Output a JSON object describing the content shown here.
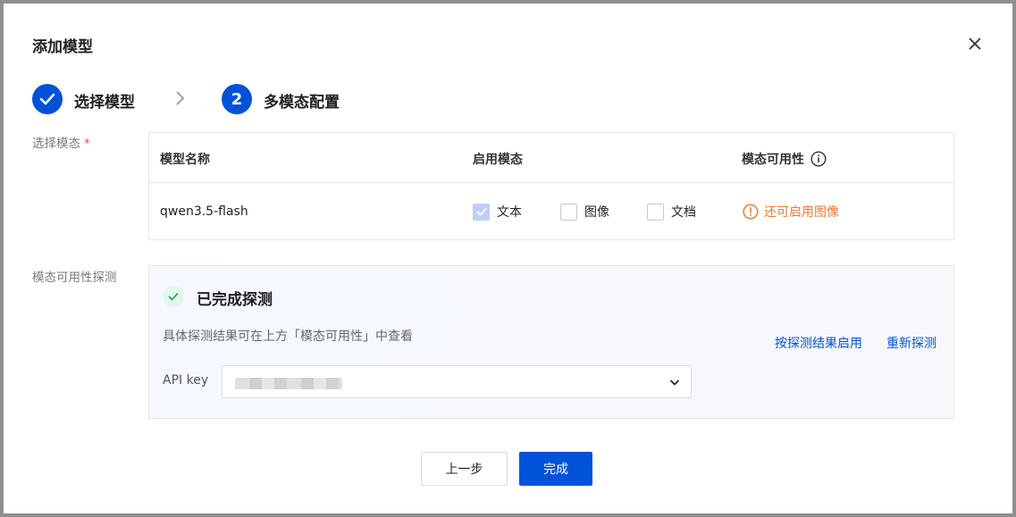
{
  "dialog": {
    "title": "添加模型"
  },
  "steps": [
    {
      "label": "选择模型",
      "status": "done"
    },
    {
      "label": "多模态配置",
      "number": "2",
      "status": "active"
    }
  ],
  "select_modality": {
    "label": "选择模态",
    "required_mark": "*",
    "columns": [
      "模型名称",
      "启用模态",
      "模态可用性"
    ],
    "rows": [
      {
        "model": "qwen3.5-flash",
        "modalities": [
          {
            "label": "文本",
            "checked": true
          },
          {
            "label": "图像",
            "checked": false
          },
          {
            "label": "文档",
            "checked": false
          }
        ],
        "availability": "还可启用图像"
      }
    ]
  },
  "probe": {
    "label": "模态可用性探测",
    "status_title": "已完成探测",
    "description": "具体探测结果可在上方「模态可用性」中查看",
    "enable_by_result": "按探测结果启用",
    "reprobe": "重新探测",
    "api_key_label": "API key"
  },
  "footer": {
    "prev": "上一步",
    "done": "完成"
  },
  "colors": {
    "primary": "#0052d9",
    "warning": "#ed7b2f",
    "success": "#2ba471",
    "required": "#e34d59"
  }
}
